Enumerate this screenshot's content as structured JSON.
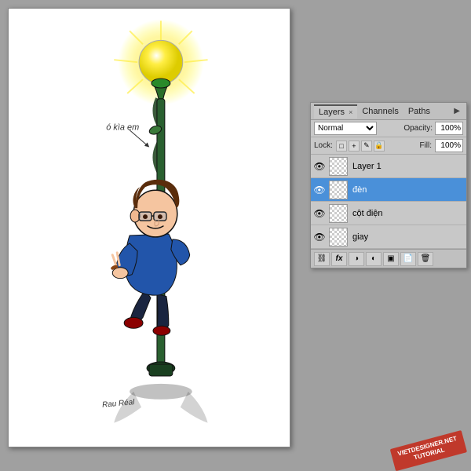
{
  "panel": {
    "tabs": [
      {
        "id": "layers",
        "label": "Layers",
        "active": true,
        "has_close": true
      },
      {
        "id": "channels",
        "label": "Channels",
        "active": false
      },
      {
        "id": "paths",
        "label": "Paths",
        "active": false
      }
    ],
    "expand_icon": "▶",
    "blend_mode": {
      "label": "Normal",
      "opacity_label": "Opacity:",
      "opacity_value": "100%"
    },
    "lock_row": {
      "label": "Lock:",
      "lock_icons": [
        "□",
        "+",
        "✎",
        "🔒"
      ],
      "fill_label": "Fill:",
      "fill_value": "100%"
    },
    "layers": [
      {
        "id": "layer1",
        "name": "Layer 1",
        "visible": true,
        "selected": false
      },
      {
        "id": "den",
        "name": "đèn",
        "visible": true,
        "selected": true
      },
      {
        "id": "cotdien",
        "name": "cột điện",
        "visible": true,
        "selected": false
      },
      {
        "id": "giay",
        "name": "giay",
        "visible": true,
        "selected": false
      }
    ],
    "toolbar_buttons": [
      {
        "id": "link",
        "icon": "⛓",
        "label": "link"
      },
      {
        "id": "fx",
        "icon": "fx",
        "label": "effects"
      },
      {
        "id": "mask",
        "icon": "◑",
        "label": "mask"
      },
      {
        "id": "adj",
        "icon": "◐",
        "label": "adjustment"
      },
      {
        "id": "folder",
        "icon": "📁",
        "label": "group"
      },
      {
        "id": "new",
        "icon": "📄",
        "label": "new-layer"
      },
      {
        "id": "delete",
        "icon": "🗑",
        "label": "delete"
      }
    ]
  },
  "watermark": {
    "line1": "VIETDESIGNER.NET",
    "line2": "TUTORIAL"
  },
  "canvas": {
    "alt": "Boy hugging glowing street lamp illustration"
  }
}
